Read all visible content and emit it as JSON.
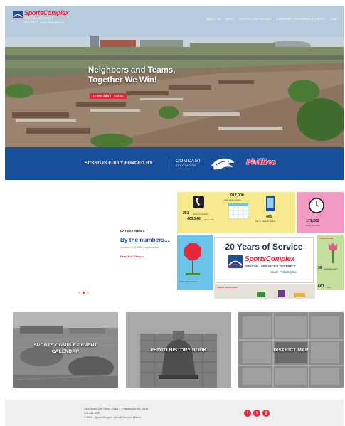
{
  "colors": {
    "brand_red": "#e5283a",
    "brand_blue": "#1a4f9c",
    "footer_bg": "#efefef"
  },
  "logo": {
    "name": "SportsComplex",
    "line2": "SPECIAL SERVICES DISTRICT",
    "line3": "South Philadelphia"
  },
  "nav": {
    "items": [
      "ABOUT US",
      "NEWS",
      "SPORTS COMPLEX MAP",
      "COMMUNITY PROGRAMS & EVENTS",
      "CONT"
    ]
  },
  "hero": {
    "headline_line1": "Neighbors and Teams,",
    "headline_line2": "Together We Win!",
    "button_label": "LEARN ABOUT SCSSD"
  },
  "funding": {
    "label": "SCSSD IS FULLY FUNDED BY",
    "comcast_line1": "COMCAST",
    "comcast_line2": "SPECTACOR",
    "phillies": "Phillies"
  },
  "news": {
    "kicker": "LATEST NEWS",
    "title": "By the numbers...",
    "excerpt": "A review of SCSSD programs and...",
    "link": "Read Full Story >",
    "slide_dots": [
      false,
      true,
      false
    ]
  },
  "infographic": {
    "stat1_num": "917,000",
    "stat1_label": "trash bags emptied",
    "stat2_num": "351",
    "stat2_label": "hours of outreach",
    "stat3_num": "403,946",
    "stat3_label": "phone calls",
    "stat4_num": "465",
    "stat4_label": "Clip It! Cleanup hotline",
    "stat5_num": "171,262",
    "stat5_label": "hours of service",
    "stat6_num": "36",
    "stat6_label": "landscape sites",
    "stat7_num": "661",
    "stat7_label": "trees",
    "stat8_label": "Traffic safety devices",
    "label_green": "STREETSCAPE",
    "label_gray": "GREEN OPERATIONS",
    "banner_title": "20 Years of Service",
    "banner_logo1": "SportsComplex",
    "banner_logo2": "SPECIAL SERVICES DISTRICT",
    "banner_logo3": "South Philadelphia"
  },
  "cards": [
    {
      "title_line1": "SPORTS COMPLEX EVENT",
      "title_line2": "CALENDAR"
    },
    {
      "title_line1": "PHOTO HISTORY BOOK",
      "title_line2": ""
    },
    {
      "title_line1": "DISTRICT MAP",
      "title_line2": ""
    }
  ],
  "footer": {
    "address": "3300 South 20th Street - Suite 2, Philadelphia, PA 19145",
    "phone": "215-336-1000",
    "copyright": "© 2019 - Sports Complex Special Services District",
    "social_icons": [
      "facebook-icon",
      "twitter-icon",
      "instagram-icon"
    ]
  }
}
